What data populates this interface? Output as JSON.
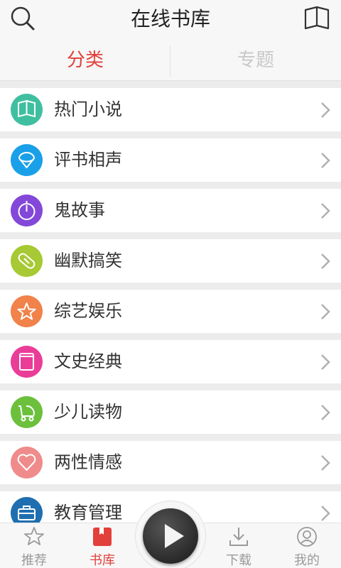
{
  "header": {
    "title": "在线书库",
    "search_icon": "search-icon",
    "book_icon": "book-open-icon"
  },
  "tabs": [
    {
      "label": "分类",
      "active": true
    },
    {
      "label": "专题",
      "active": false
    }
  ],
  "categories": [
    {
      "label": "热门小说",
      "icon": "book-open-icon",
      "color": "#3fbfa0"
    },
    {
      "label": "评书相声",
      "icon": "fan-icon",
      "color": "#1aa0e8"
    },
    {
      "label": "鬼故事",
      "icon": "timer-icon",
      "color": "#8348d8"
    },
    {
      "label": "幽默搞笑",
      "icon": "pill-icon",
      "color": "#a6c934"
    },
    {
      "label": "综艺娱乐",
      "icon": "star-icon",
      "color": "#f0824a"
    },
    {
      "label": "文史经典",
      "icon": "notebook-icon",
      "color": "#ea3d98"
    },
    {
      "label": "少儿读物",
      "icon": "stroller-icon",
      "color": "#6cc03c"
    },
    {
      "label": "两性情感",
      "icon": "heart-icon",
      "color": "#f08b8b"
    },
    {
      "label": "教育管理",
      "icon": "briefcase-icon",
      "color": "#1f6fb0"
    }
  ],
  "bottom_nav": [
    {
      "label": "推荐",
      "icon": "star-outline-icon",
      "active": false
    },
    {
      "label": "书库",
      "icon": "bookshelf-icon",
      "active": true
    },
    {
      "label": "下载",
      "icon": "download-icon",
      "active": false
    },
    {
      "label": "我的",
      "icon": "user-icon",
      "active": false
    }
  ],
  "player": {
    "icon": "play-icon"
  },
  "colors": {
    "accent": "#e2403a",
    "inactive": "#9a9a9a"
  }
}
